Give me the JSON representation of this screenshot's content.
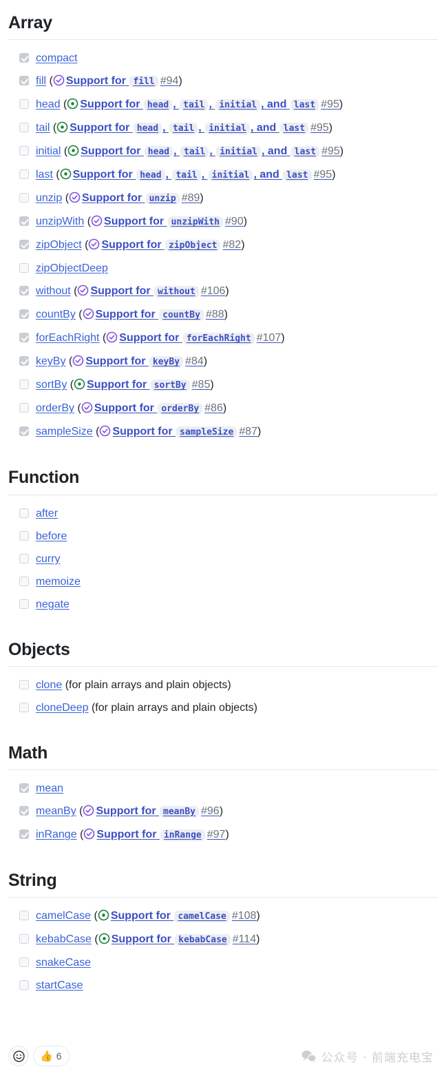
{
  "page": {
    "title": "Lodash function support checklist",
    "colors": {
      "link": "#3a62d8",
      "pr_link": "#3b4fc4",
      "merged_pr_icon": "#8250df",
      "open_pr_icon": "#1a7f37",
      "text": "#1f2328",
      "muted": "#6a737d",
      "code_bg": "#eceef1",
      "checkbox_checked_bg": "#c8cdd3"
    }
  },
  "sections": [
    {
      "heading": "Array",
      "items": [
        {
          "checked": true,
          "name": "compact",
          "pr": null
        },
        {
          "checked": true,
          "name": "fill",
          "pr": {
            "state": "merged",
            "prefix": "Support for",
            "codes": [
              "fill"
            ],
            "separators": [],
            "number": "#94"
          }
        },
        {
          "checked": false,
          "name": "head",
          "pr": {
            "state": "open",
            "prefix": "Support for",
            "codes": [
              "head",
              "tail",
              "initial",
              "last"
            ],
            "separators": [
              ", ",
              ", ",
              ", and "
            ],
            "number": "#95"
          }
        },
        {
          "checked": false,
          "name": "tail",
          "pr": {
            "state": "open",
            "prefix": "Support for",
            "codes": [
              "head",
              "tail",
              "initial",
              "last"
            ],
            "separators": [
              ", ",
              ", ",
              ", and "
            ],
            "number": "#95"
          }
        },
        {
          "checked": false,
          "name": "initial",
          "pr": {
            "state": "open",
            "prefix": "Support for",
            "codes": [
              "head",
              "tail",
              "initial",
              "last"
            ],
            "separators": [
              ", ",
              ", ",
              ", and "
            ],
            "number": "#95"
          }
        },
        {
          "checked": false,
          "name": "last",
          "pr": {
            "state": "open",
            "prefix": "Support for",
            "codes": [
              "head",
              "tail",
              "initial",
              "last"
            ],
            "separators": [
              ", ",
              ", ",
              ", and "
            ],
            "number": "#95"
          }
        },
        {
          "checked": false,
          "name": "unzip",
          "pr": {
            "state": "merged",
            "prefix": "Support for",
            "codes": [
              "unzip"
            ],
            "separators": [],
            "number": "#89"
          }
        },
        {
          "checked": true,
          "name": "unzipWith",
          "pr": {
            "state": "merged",
            "prefix": "Support for",
            "codes": [
              "unzipWith"
            ],
            "separators": [],
            "number": "#90"
          }
        },
        {
          "checked": true,
          "name": "zipObject",
          "pr": {
            "state": "merged",
            "prefix": "Support for",
            "codes": [
              "zipObject"
            ],
            "separators": [],
            "number": "#82"
          }
        },
        {
          "checked": false,
          "name": "zipObjectDeep",
          "pr": null
        },
        {
          "checked": true,
          "name": "without",
          "pr": {
            "state": "merged",
            "prefix": "Support for",
            "codes": [
              "without"
            ],
            "separators": [],
            "number": "#106"
          }
        },
        {
          "checked": true,
          "name": "countBy",
          "pr": {
            "state": "merged",
            "prefix": "Support for",
            "codes": [
              "countBy"
            ],
            "separators": [],
            "number": "#88"
          }
        },
        {
          "checked": true,
          "name": "forEachRight",
          "pr": {
            "state": "merged",
            "prefix": "Support for",
            "codes": [
              "forEachRight"
            ],
            "separators": [],
            "number": "#107"
          }
        },
        {
          "checked": true,
          "name": "keyBy",
          "pr": {
            "state": "merged",
            "prefix": "Support for",
            "codes": [
              "keyBy"
            ],
            "separators": [],
            "number": "#84"
          }
        },
        {
          "checked": false,
          "name": "sortBy",
          "pr": {
            "state": "open",
            "prefix": "Support for",
            "codes": [
              "sortBy"
            ],
            "separators": [],
            "number": "#85"
          }
        },
        {
          "checked": false,
          "name": "orderBy",
          "pr": {
            "state": "merged",
            "prefix": "Support for",
            "codes": [
              "orderBy"
            ],
            "separators": [],
            "number": "#86"
          }
        },
        {
          "checked": true,
          "name": "sampleSize",
          "pr": {
            "state": "merged",
            "prefix": "Support for",
            "codes": [
              "sampleSize"
            ],
            "separators": [],
            "number": "#87"
          }
        }
      ]
    },
    {
      "heading": "Function",
      "items": [
        {
          "checked": false,
          "name": "after",
          "pr": null
        },
        {
          "checked": false,
          "name": "before",
          "pr": null
        },
        {
          "checked": false,
          "name": "curry",
          "pr": null
        },
        {
          "checked": false,
          "name": "memoize",
          "pr": null
        },
        {
          "checked": false,
          "name": "negate",
          "pr": null
        }
      ]
    },
    {
      "heading": "Objects",
      "items": [
        {
          "checked": false,
          "name": "clone",
          "pr": null,
          "note": "(for plain arrays and plain objects)"
        },
        {
          "checked": false,
          "name": "cloneDeep",
          "pr": null,
          "note": "(for plain arrays and plain objects)"
        }
      ]
    },
    {
      "heading": "Math",
      "items": [
        {
          "checked": true,
          "name": "mean",
          "pr": null
        },
        {
          "checked": true,
          "name": "meanBy",
          "pr": {
            "state": "merged",
            "prefix": "Support for",
            "codes": [
              "meanBy"
            ],
            "separators": [],
            "number": "#96"
          }
        },
        {
          "checked": true,
          "name": "inRange",
          "pr": {
            "state": "merged",
            "prefix": "Support for",
            "codes": [
              "inRange"
            ],
            "separators": [],
            "number": "#97"
          }
        }
      ]
    },
    {
      "heading": "String",
      "items": [
        {
          "checked": false,
          "name": "camelCase",
          "pr": {
            "state": "open",
            "prefix": "Support for",
            "codes": [
              "camelCase"
            ],
            "separators": [],
            "number": "#108"
          }
        },
        {
          "checked": false,
          "name": "kebabCase",
          "pr": {
            "state": "open",
            "prefix": "Support for",
            "codes": [
              "kebabCase"
            ],
            "separators": [],
            "number": "#114"
          }
        },
        {
          "checked": false,
          "name": "snakeCase",
          "pr": null
        },
        {
          "checked": false,
          "name": "startCase",
          "pr": null
        }
      ]
    }
  ],
  "footer": {
    "add_reaction_icon": "smiley-face-icon",
    "reactions": [
      {
        "emoji": "👍",
        "name": "thumbs-up",
        "count": "6"
      }
    ],
    "watermark": {
      "icon": "wechat-icon",
      "text": "公众号 · 前端充电宝"
    }
  }
}
